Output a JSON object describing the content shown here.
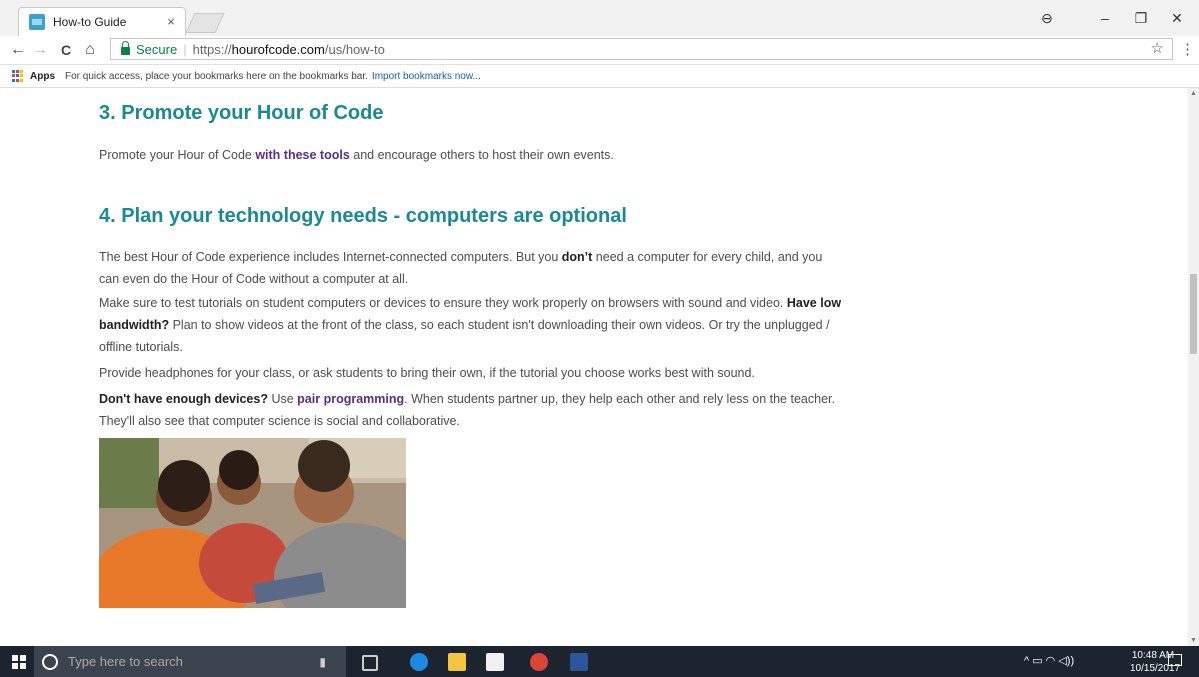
{
  "browser": {
    "tab_title": "How-to Guide",
    "tab_close": "×",
    "secure_label": "Secure",
    "url_scheme": "https://",
    "url_host": "hourofcode.com",
    "url_path": "/us/how-to",
    "bookmarks_apps": "Apps",
    "bookmarks_hint": "For quick access, place your bookmarks here on the bookmarks bar.",
    "bookmarks_import": "Import bookmarks now...",
    "window_controls": [
      "–",
      "❐",
      "✕"
    ],
    "nav_icons": [
      "←",
      "→",
      "C",
      "⌂"
    ],
    "star_icon": "☆",
    "menu_icon": "⋮",
    "profile_icon": "⊖"
  },
  "content": {
    "section3": {
      "heading": "3. Promote your Hour of Code",
      "p_before": "Promote your Hour of Code ",
      "p_link": "with these tools",
      "p_after": " and encourage others to host their own events."
    },
    "section4": {
      "heading": "4. Plan your technology needs - computers are optional",
      "p1_before": "The best Hour of Code experience includes Internet-connected computers. But you ",
      "p1_bold": "don’t",
      "p1_after": " need a computer for every child, and you can even do the Hour of Code without a computer at all.",
      "p2_before": "Make sure to test tutorials on student computers or devices to ensure they work properly on browsers with sound and video. ",
      "p2_bold": "Have low bandwidth?",
      "p2_after": " Plan to show videos at the front of the class, so each student isn't downloading their own videos. Or try the unplugged / offline tutorials.",
      "p3": "Provide headphones for your class, or ask students to bring their own, if the tutorial you choose works best with sound.",
      "p4_bold": "Don't have enough devices?",
      "p4_mid": " Use ",
      "p4_link": "pair programming",
      "p4_after": ". When students partner up, they help each other and rely less on the teacher. They'll also see that computer science is social and collaborative."
    },
    "colors": {
      "heading": "#198a92",
      "link": "#5a2d86"
    }
  },
  "taskbar": {
    "search_placeholder": "Type here to search",
    "time": "10:48 AM",
    "date": "10/15/2017",
    "tray_icons": "^  ▭  ◠  ◁))"
  }
}
